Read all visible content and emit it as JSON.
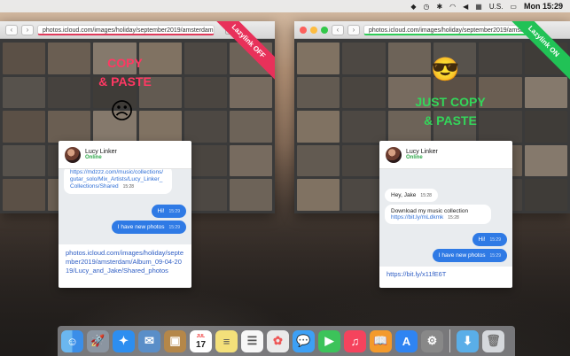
{
  "menubar": {
    "lang": "U.S.",
    "clock": "Mon 15:29"
  },
  "left_window": {
    "url": "photos.icloud.com/images/holiday/september2019/amsterdam...",
    "ribbon": "Lazylink OFF",
    "slogan_line1": "COPY",
    "slogan_line2": "& PASTE",
    "emoji": "☹"
  },
  "right_window": {
    "url": "photos.icloud.com/images/holiday/september2019/amsterdam...",
    "ribbon": "Lazylink ON",
    "slogan_line1": "JUST COPY",
    "slogan_line2": "& PASTE",
    "emoji": "😎"
  },
  "chat_left": {
    "name": "Lucy Linker",
    "status": "Online",
    "messages": [
      {
        "dir": "in",
        "text": "https://mdzzz.com/music/collections/gutar_solo/Mix_Artists/Lucy_Linker_Collections/Shared",
        "time": "15:28"
      },
      {
        "dir": "out",
        "text": "Hi!",
        "time": "15:29"
      },
      {
        "dir": "out",
        "text": "I have new photos",
        "time": "15:29"
      }
    ],
    "compose": "photos.icloud.com/images/holiday/september2019/amsterdam/Album_09-04-2019/Lucy_and_Jake/Shared_photos"
  },
  "chat_right": {
    "name": "Lucy Linker",
    "status": "Online",
    "messages": [
      {
        "dir": "in",
        "text": "Hey, Jake",
        "time": "15:28"
      },
      {
        "dir": "in",
        "text": "Download my music collection",
        "link": "https://bit.ly/mLdkmk",
        "time": "15:28"
      },
      {
        "dir": "out",
        "text": "Hi!",
        "time": "15:29"
      },
      {
        "dir": "out",
        "text": "I have new photos",
        "time": "15:29"
      }
    ],
    "compose": "https://bit.ly/x11fE6T"
  },
  "dock": {
    "apps": [
      "finder-icon",
      "launchpad-icon",
      "safari-icon",
      "mail-icon",
      "contacts-icon",
      "calendar-icon",
      "notes-icon",
      "reminders-icon",
      "photos-icon",
      "messages-icon",
      "facetime-icon",
      "music-icon",
      "books-icon",
      "app-store-icon",
      "system-preferences-icon",
      "downloads-folder-icon",
      "trash-icon"
    ],
    "calendar_day": "17",
    "calendar_month": "JUL"
  }
}
